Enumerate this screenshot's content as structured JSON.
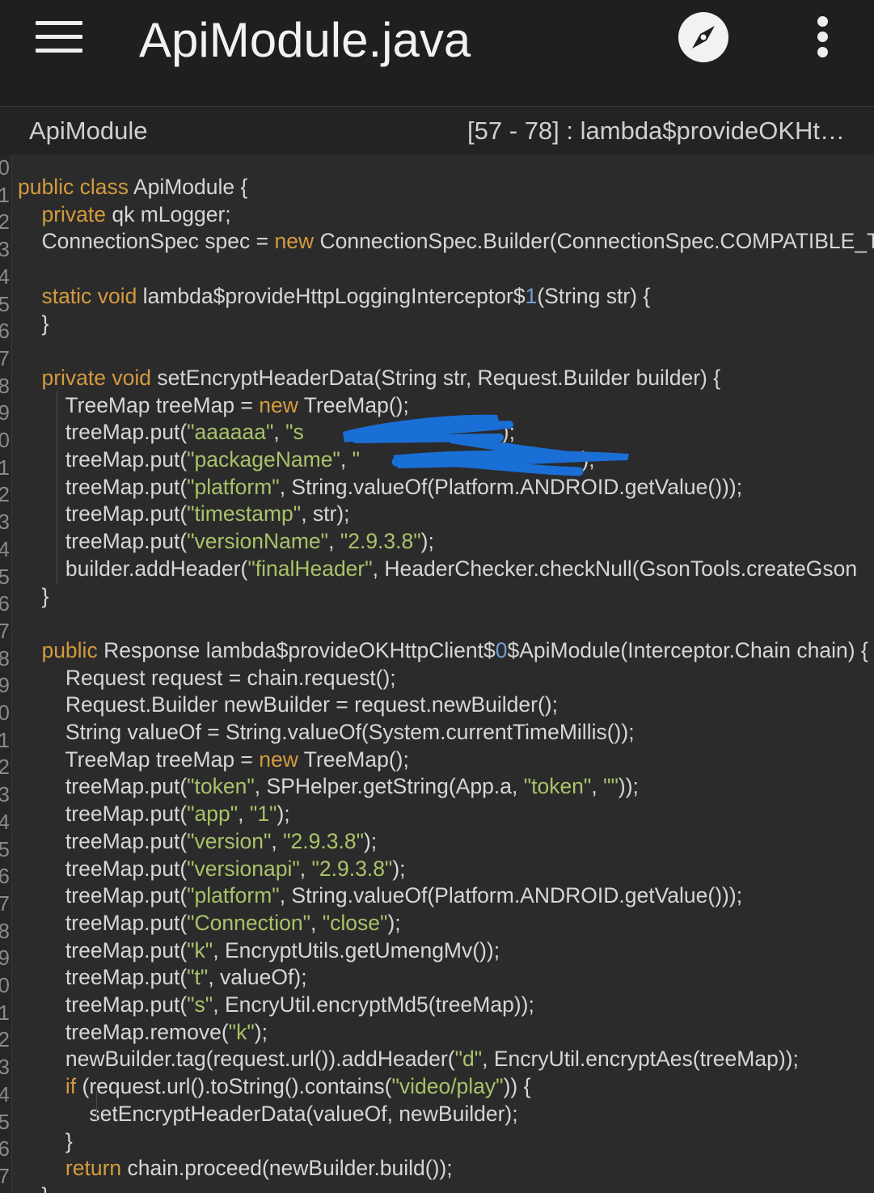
{
  "header": {
    "title": "ApiModule.java"
  },
  "subheader": {
    "class_name": "ApiModule",
    "method_range": "[57 - 78] : lambda$provideOKHt…"
  },
  "icons": {
    "menu": "hamburger-menu-icon",
    "navigate": "compass-icon",
    "more": "more-vertical-icon"
  },
  "colors": {
    "background": "#2b2b2b",
    "toolbar": "#1f1f1f",
    "keyword": "#d49a3e",
    "string": "#a9c36a",
    "number": "#6f9fd8",
    "text": "#d6d6d6",
    "redaction": "#1a6fd6"
  },
  "gutter": [
    "0",
    "1",
    "2",
    "3",
    "4",
    "5",
    "6",
    "7",
    "8",
    "9",
    "0",
    "1",
    "2",
    "3",
    "4",
    "5",
    "6",
    "7",
    "8",
    "9",
    "0",
    "1",
    "2",
    "3",
    "4",
    "5",
    "6",
    "7",
    "8",
    "9",
    "0",
    "1",
    "2",
    "3",
    "4",
    "5",
    "6",
    "7"
  ],
  "code": {
    "lines": [
      [
        [
          "kw",
          "public"
        ],
        [
          "t",
          " "
        ],
        [
          "kw",
          "class"
        ],
        [
          "t",
          " ApiModule {"
        ]
      ],
      [
        [
          "t",
          "    "
        ],
        [
          "kw",
          "private"
        ],
        [
          "t",
          " qk mLogger;"
        ]
      ],
      [
        [
          "t",
          "    ConnectionSpec spec = "
        ],
        [
          "kw",
          "new"
        ],
        [
          "t",
          " ConnectionSpec.Builder(ConnectionSpec.COMPATIBLE_TLS)"
        ]
      ],
      [],
      [
        [
          "t",
          "    "
        ],
        [
          "kw",
          "static"
        ],
        [
          "t",
          " "
        ],
        [
          "kw",
          "void"
        ],
        [
          "t",
          " lambda$provideHttpLoggingInterceptor$"
        ],
        [
          "num",
          "1"
        ],
        [
          "t",
          "(String str) {"
        ]
      ],
      [
        [
          "t",
          "    }"
        ]
      ],
      [],
      [
        [
          "t",
          "    "
        ],
        [
          "kw",
          "private"
        ],
        [
          "t",
          " "
        ],
        [
          "kw",
          "void"
        ],
        [
          "t",
          " setEncryptHeaderData(String str, Request.Builder builder) {"
        ]
      ],
      [
        [
          "t",
          "        TreeMap treeMap = "
        ],
        [
          "kw",
          "new"
        ],
        [
          "t",
          " TreeMap();"
        ]
      ],
      [
        [
          "t",
          "        treeMap.put("
        ],
        [
          "str",
          "\"aaaaaa\""
        ],
        [
          "t",
          ", "
        ],
        [
          "str",
          "\"s                                \""
        ],
        [
          "t",
          ");"
        ]
      ],
      [
        [
          "t",
          "        treeMap.put("
        ],
        [
          "str",
          "\"packageName\""
        ],
        [
          "t",
          ", "
        ],
        [
          "str",
          "\"                                    \""
        ],
        [
          "t",
          ");"
        ]
      ],
      [
        [
          "t",
          "        treeMap.put("
        ],
        [
          "str",
          "\"platform\""
        ],
        [
          "t",
          ", String.valueOf(Platform.ANDROID.getValue()));"
        ]
      ],
      [
        [
          "t",
          "        treeMap.put("
        ],
        [
          "str",
          "\"timestamp\""
        ],
        [
          "t",
          ", str);"
        ]
      ],
      [
        [
          "t",
          "        treeMap.put("
        ],
        [
          "str",
          "\"versionName\""
        ],
        [
          "t",
          ", "
        ],
        [
          "str",
          "\"2.9.3.8\""
        ],
        [
          "t",
          ");"
        ]
      ],
      [
        [
          "t",
          "        builder.addHeader("
        ],
        [
          "str",
          "\"finalHeader\""
        ],
        [
          "t",
          ", HeaderChecker.checkNull(GsonTools.createGson"
        ]
      ],
      [
        [
          "t",
          "    }"
        ]
      ],
      [],
      [
        [
          "t",
          "    "
        ],
        [
          "kw",
          "public"
        ],
        [
          "t",
          " Response lambda$provideOKHttpClient$"
        ],
        [
          "num",
          "0"
        ],
        [
          "t",
          "$ApiModule(Interceptor.Chain chain) {"
        ]
      ],
      [
        [
          "t",
          "        Request request = chain.request();"
        ]
      ],
      [
        [
          "t",
          "        Request.Builder newBuilder = request.newBuilder();"
        ]
      ],
      [
        [
          "t",
          "        String valueOf = String.valueOf(System.currentTimeMillis());"
        ]
      ],
      [
        [
          "t",
          "        TreeMap treeMap = "
        ],
        [
          "kw",
          "new"
        ],
        [
          "t",
          " TreeMap();"
        ]
      ],
      [
        [
          "t",
          "        treeMap.put("
        ],
        [
          "str",
          "\"token\""
        ],
        [
          "t",
          ", SPHelper.getString(App.a, "
        ],
        [
          "str",
          "\"token\""
        ],
        [
          "t",
          ", "
        ],
        [
          "str",
          "\"\""
        ],
        [
          "t",
          "));"
        ]
      ],
      [
        [
          "t",
          "        treeMap.put("
        ],
        [
          "str",
          "\"app\""
        ],
        [
          "t",
          ", "
        ],
        [
          "str",
          "\"1\""
        ],
        [
          "t",
          ");"
        ]
      ],
      [
        [
          "t",
          "        treeMap.put("
        ],
        [
          "str",
          "\"version\""
        ],
        [
          "t",
          ", "
        ],
        [
          "str",
          "\"2.9.3.8\""
        ],
        [
          "t",
          ");"
        ]
      ],
      [
        [
          "t",
          "        treeMap.put("
        ],
        [
          "str",
          "\"versionapi\""
        ],
        [
          "t",
          ", "
        ],
        [
          "str",
          "\"2.9.3.8\""
        ],
        [
          "t",
          ");"
        ]
      ],
      [
        [
          "t",
          "        treeMap.put("
        ],
        [
          "str",
          "\"platform\""
        ],
        [
          "t",
          ", String.valueOf(Platform.ANDROID.getValue()));"
        ]
      ],
      [
        [
          "t",
          "        treeMap.put("
        ],
        [
          "str",
          "\"Connection\""
        ],
        [
          "t",
          ", "
        ],
        [
          "str",
          "\"close\""
        ],
        [
          "t",
          ");"
        ]
      ],
      [
        [
          "t",
          "        treeMap.put("
        ],
        [
          "str",
          "\"k\""
        ],
        [
          "t",
          ", EncryptUtils.getUmengMv());"
        ]
      ],
      [
        [
          "t",
          "        treeMap.put("
        ],
        [
          "str",
          "\"t\""
        ],
        [
          "t",
          ", valueOf);"
        ]
      ],
      [
        [
          "t",
          "        treeMap.put("
        ],
        [
          "str",
          "\"s\""
        ],
        [
          "t",
          ", EncryUtil.encryptMd5(treeMap));"
        ]
      ],
      [
        [
          "t",
          "        treeMap.remove("
        ],
        [
          "str",
          "\"k\""
        ],
        [
          "t",
          ");"
        ]
      ],
      [
        [
          "t",
          "        newBuilder.tag(request.url()).addHeader("
        ],
        [
          "str",
          "\"d\""
        ],
        [
          "t",
          ", EncryUtil.encryptAes(treeMap));"
        ]
      ],
      [
        [
          "t",
          "        "
        ],
        [
          "kw",
          "if"
        ],
        [
          "t",
          " (request.url().toString().contains("
        ],
        [
          "str",
          "\"video/play\""
        ],
        [
          "t",
          ")) {"
        ]
      ],
      [
        [
          "t",
          "            setEncryptHeaderData(valueOf, newBuilder);"
        ]
      ],
      [
        [
          "t",
          "        }"
        ]
      ],
      [
        [
          "t",
          "        "
        ],
        [
          "kw",
          "return"
        ],
        [
          "t",
          " chain.proceed(newBuilder.build());"
        ]
      ],
      [
        [
          "t",
          "    }"
        ]
      ]
    ]
  }
}
